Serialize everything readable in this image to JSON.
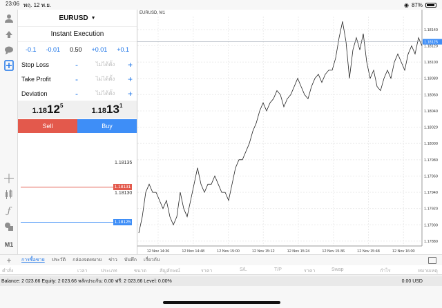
{
  "status_bar": {
    "time": "23:06",
    "date": "พฤ. 12 พ.ย.",
    "battery": "87%"
  },
  "order": {
    "symbol": "EURUSD",
    "execution": "Instant Execution",
    "steps": [
      "-0.1",
      "-0.01",
      "0.50",
      "+0.01",
      "+0.1"
    ],
    "params": [
      {
        "label": "Stop Loss",
        "placeholder": "ไม่ได้ตั้ง"
      },
      {
        "label": "Take Profit",
        "placeholder": "ไม่ได้ตั้ง"
      },
      {
        "label": "Deviation",
        "placeholder": "ไม่ได้ตั้ง"
      }
    ],
    "bid": {
      "small": "1.18",
      "big": "12",
      "sup": "5"
    },
    "ask": {
      "small": "1.18",
      "big": "13",
      "sup": "1"
    },
    "sell_label": "Sell",
    "buy_label": "Buy"
  },
  "depth": {
    "top_price": "1.18135",
    "ask_price": "1.18131",
    "mid_price": "1.18130",
    "bid_price": "1.18125",
    "ask_color": "#e3594c",
    "bid_color": "#3e8ef7"
  },
  "chart_data": {
    "type": "line",
    "title": "EURUSD, M1",
    "x_labels": [
      "12 Nov 14:36",
      "12 Nov 14:48",
      "12 Nov 15:00",
      "12 Nov 15:12",
      "12 Nov 15:24",
      "12 Nov 15:36",
      "12 Nov 15:48",
      "12 Nov 16:00"
    ],
    "y_ticks": [
      "1.18140",
      "1.18120",
      "1.18100",
      "1.18080",
      "1.18060",
      "1.18040",
      "1.18020",
      "1.18000",
      "1.17980",
      "1.17960",
      "1.17940",
      "1.17920",
      "1.17900",
      "1.17880"
    ],
    "ylim": [
      1.17874,
      1.18156
    ],
    "current_price": "1.18125",
    "values": [
      1.1789,
      1.1791,
      1.1794,
      1.1795,
      1.1794,
      1.1794,
      1.1793,
      1.1792,
      1.1793,
      1.1791,
      1.179,
      1.1791,
      1.1794,
      1.1792,
      1.1791,
      1.1793,
      1.1795,
      1.1797,
      1.1795,
      1.1794,
      1.1795,
      1.1795,
      1.1796,
      1.1795,
      1.1794,
      1.1794,
      1.1793,
      1.1795,
      1.1797,
      1.1798,
      1.1798,
      1.1799,
      1.18,
      1.18015,
      1.18025,
      1.1804,
      1.1805,
      1.1804,
      1.1805,
      1.18055,
      1.18065,
      1.1806,
      1.18045,
      1.18055,
      1.1806,
      1.1807,
      1.1808,
      1.1807,
      1.1806,
      1.18055,
      1.1807,
      1.1808,
      1.18085,
      1.18075,
      1.18085,
      1.1809,
      1.1809,
      1.18105,
      1.1813,
      1.1815,
      1.18125,
      1.1808,
      1.18115,
      1.1813,
      1.18115,
      1.18135,
      1.181,
      1.1808,
      1.1809,
      1.1807,
      1.18065,
      1.1808,
      1.1809,
      1.1808,
      1.181,
      1.1811,
      1.181,
      1.1809,
      1.1811,
      1.1812,
      1.1811,
      1.1813,
      1.1812
    ]
  },
  "tabs": [
    "การซื้อขาย",
    "ประวัติ",
    "กล่องจดหมาย",
    "ข่าว",
    "บันทึก",
    "เกี่ยวกับ"
  ],
  "columns": [
    "คำสั่ง",
    "เวลา",
    "ประเภท",
    "ขนาด",
    "สัญลักษณ์",
    "ราคา",
    "S/L",
    "T/P",
    "ราคา",
    "Swap",
    "กำไร",
    "หมายเหตุ"
  ],
  "balance": {
    "text": "Balance: 2 023.66 Equity: 2 023.66 หลักประกัน: 0.00 ฟรี: 2 023.66 Level: 0.00%",
    "total": "0.00  USD"
  },
  "colors": {
    "accent": "#1a73e8",
    "sell": "#e3594c",
    "buy": "#3e8ef7"
  }
}
